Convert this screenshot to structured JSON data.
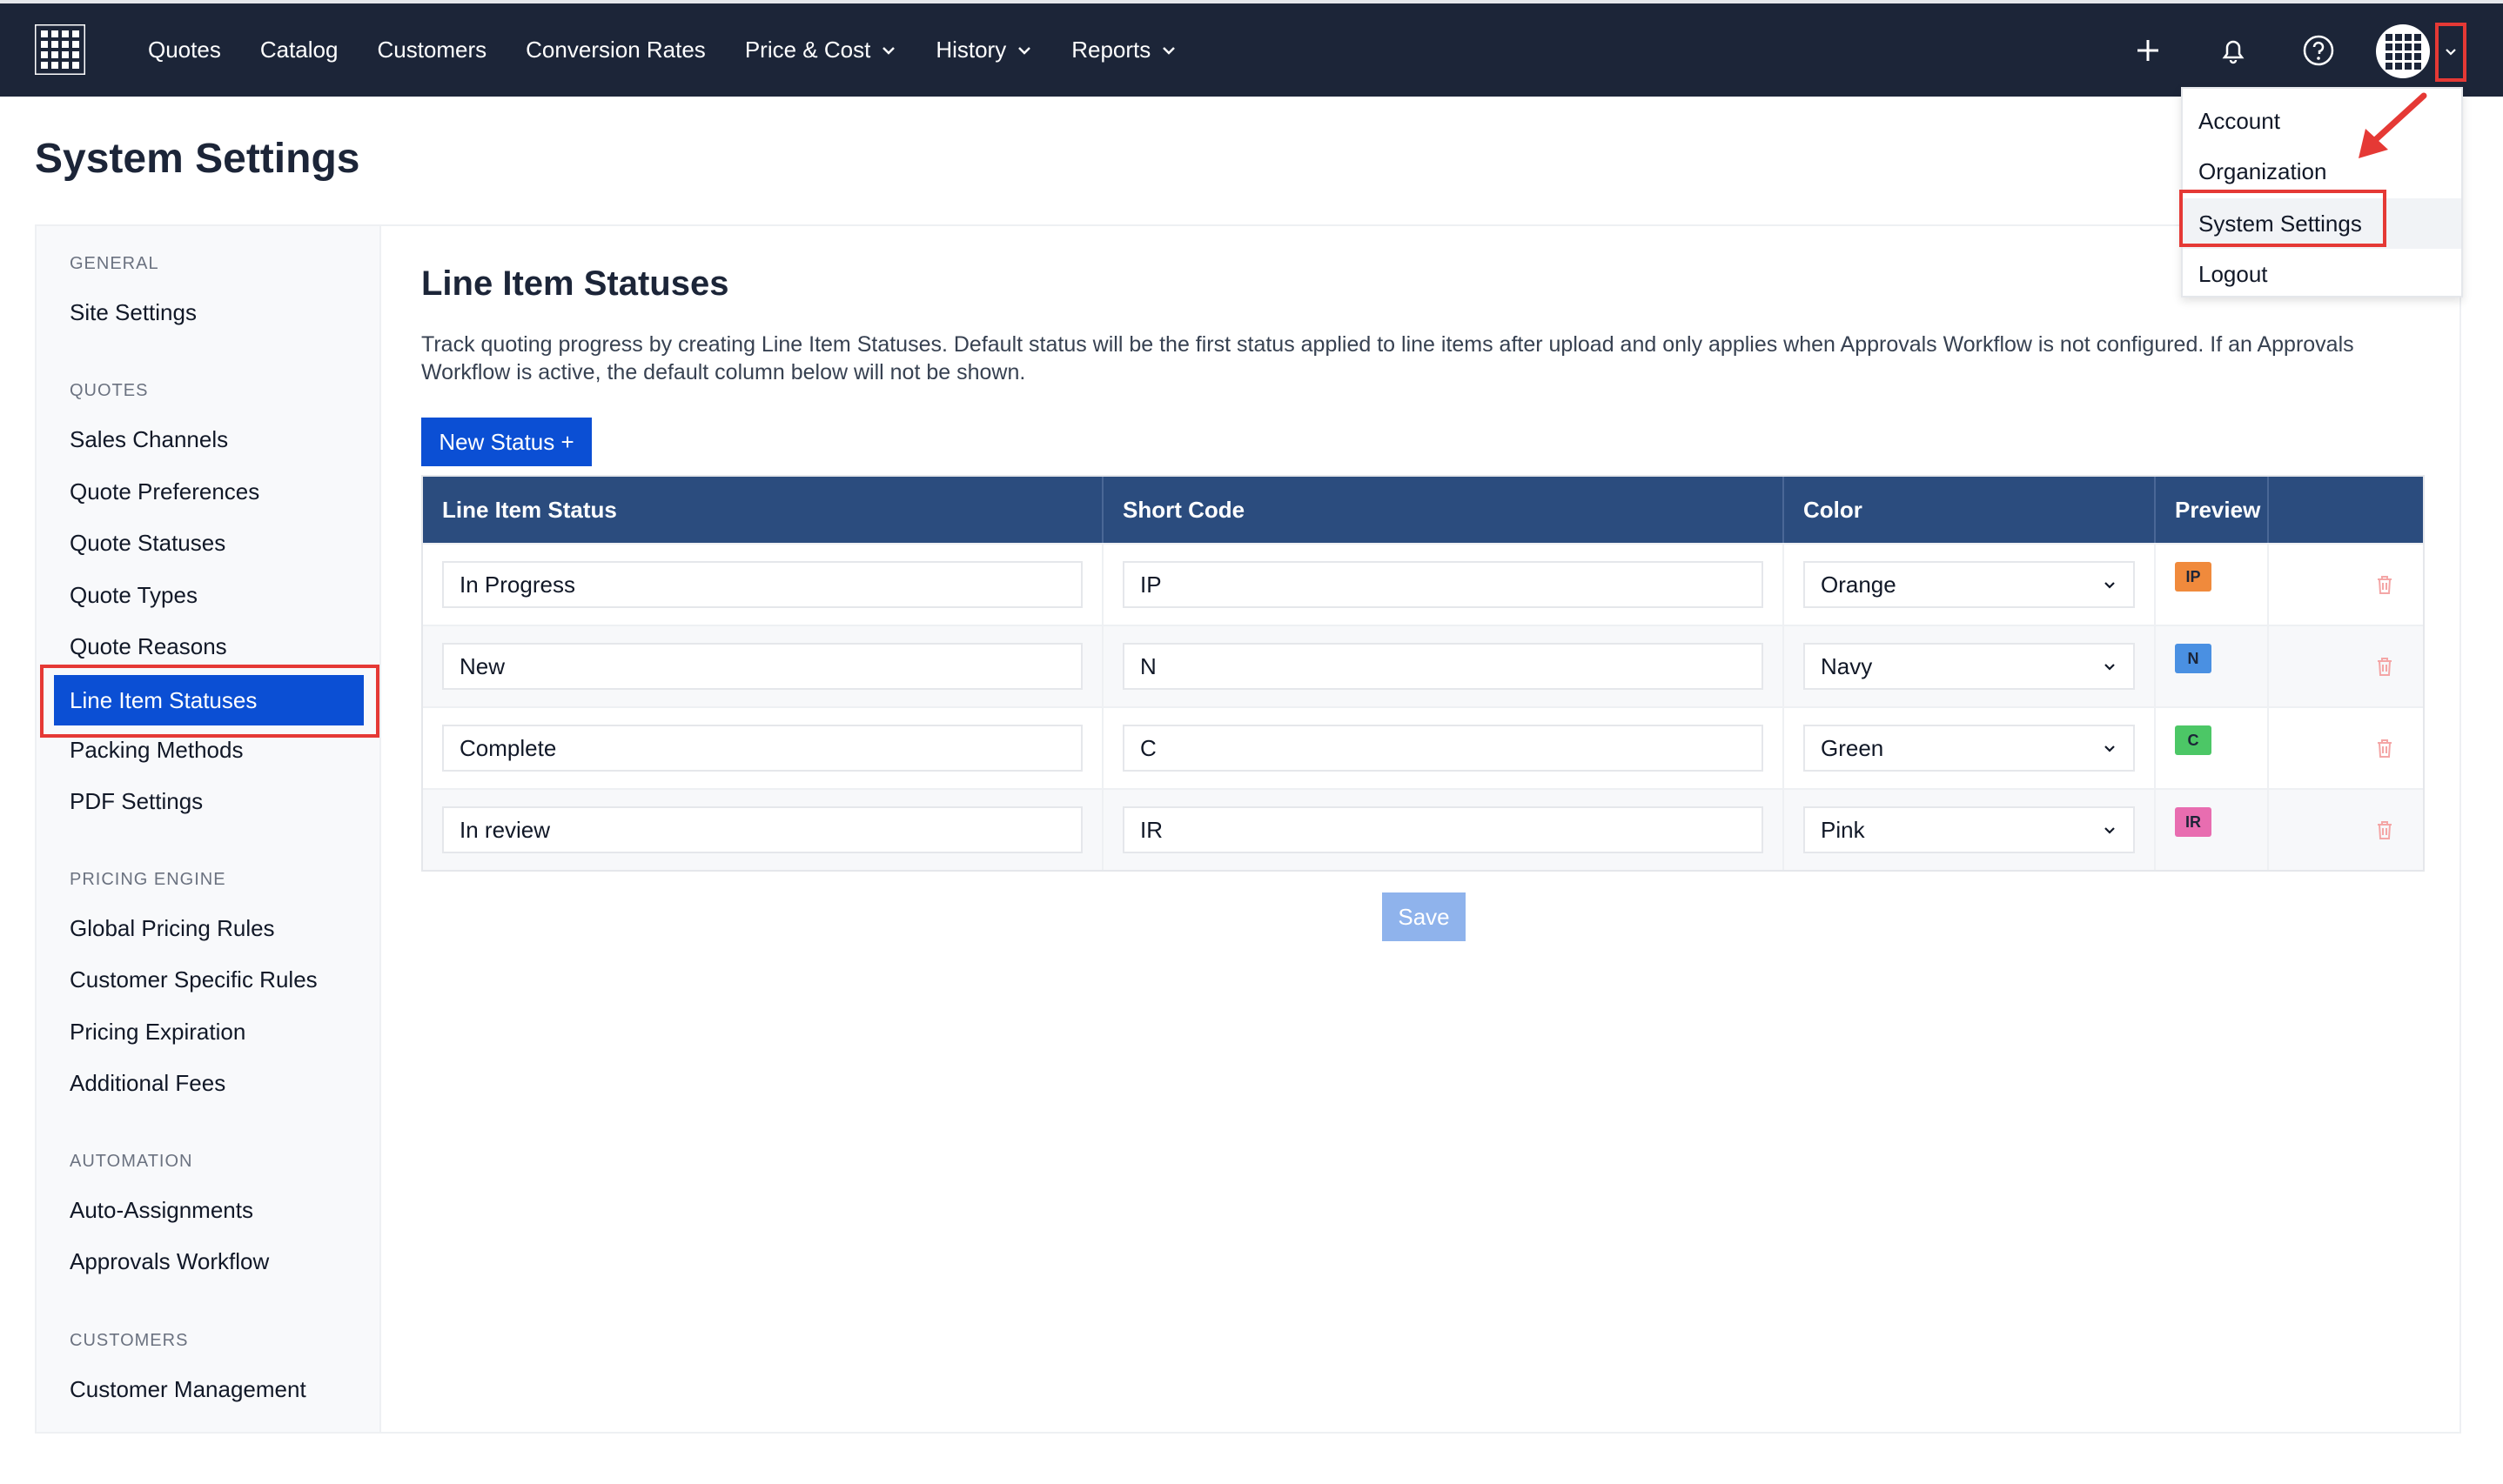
{
  "nav": {
    "items": [
      {
        "label": "Quotes"
      },
      {
        "label": "Catalog"
      },
      {
        "label": "Customers"
      },
      {
        "label": "Conversion Rates"
      },
      {
        "label": "Price & Cost"
      },
      {
        "label": "History"
      },
      {
        "label": "Reports"
      }
    ],
    "icons": [
      "grid-logo-icon",
      "plus-icon",
      "bell-icon",
      "help-icon",
      "avatar-grid-icon",
      "chevron-down-icon"
    ]
  },
  "page": {
    "title": "System Settings"
  },
  "sidebar": {
    "sections": [
      {
        "label": "GENERAL",
        "items": [
          "Site Settings"
        ]
      },
      {
        "label": "QUOTES",
        "items": [
          "Sales Channels",
          "Quote Preferences",
          "Quote Statuses",
          "Quote Types",
          "Quote Reasons",
          "Line Item Statuses",
          "Packing Methods",
          "PDF Settings"
        ]
      },
      {
        "label": "PRICING ENGINE",
        "items": [
          "Global Pricing Rules",
          "Customer Specific Rules",
          "Pricing Expiration",
          "Additional Fees"
        ]
      },
      {
        "label": "AUTOMATION",
        "items": [
          "Auto-Assignments",
          "Approvals Workflow"
        ]
      },
      {
        "label": "CUSTOMERS",
        "items": [
          "Customer Management"
        ]
      }
    ],
    "active": "Line Item Statuses"
  },
  "main": {
    "title": "Line Item Statuses",
    "description": "Track quoting progress by creating Line Item Statuses. Default status will be the first status applied to line items after upload and only applies when Approvals Workflow is not configured. If an Approvals Workflow is active, the default column below will not be shown.",
    "new_button": "New Status +",
    "save_button": "Save",
    "columns": [
      "Line Item Status",
      "Short Code",
      "Color",
      "Preview"
    ],
    "rows": [
      {
        "status": "In Progress",
        "code": "IP",
        "color": "Orange",
        "badge_color": "#f08a3c"
      },
      {
        "status": "New",
        "code": "N",
        "color": "Navy",
        "badge_color": "#4a90e2"
      },
      {
        "status": "Complete",
        "code": "C",
        "color": "Green",
        "badge_color": "#4cc766"
      },
      {
        "status": "In review",
        "code": "IR",
        "color": "Pink",
        "badge_color": "#e86db0"
      }
    ]
  },
  "user_menu": {
    "items": [
      "Account",
      "Organization",
      "System Settings",
      "Logout"
    ],
    "highlighted": "System Settings"
  },
  "colors": {
    "nav_bg": "#1c2538",
    "accent": "#0b4fd4",
    "table_header": "#2b4c7e",
    "annotation": "#e53935"
  }
}
